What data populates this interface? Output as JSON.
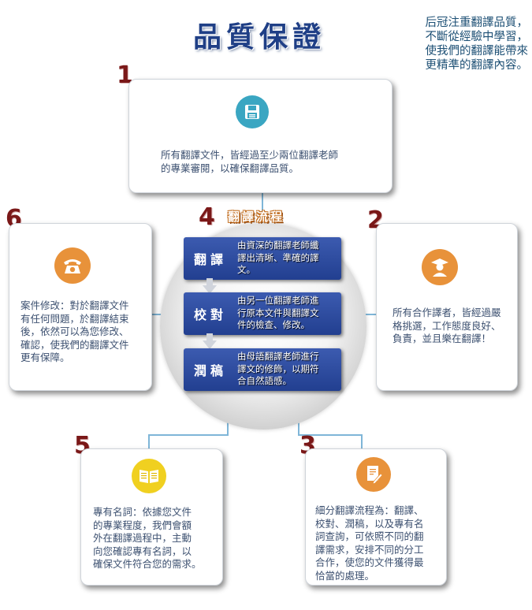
{
  "header": {
    "title": "品質保證",
    "slogan": [
      "后冠注重翻譯品質，",
      "不斷從經驗中學習，",
      "使我們的翻譯能帶來",
      "更精準的翻譯內容。"
    ]
  },
  "cards": [
    {
      "num": "1",
      "icon": "floppy-disk-icon",
      "color": "#3aa6c2",
      "lines": [
        "所有翻譯文件，皆經過至少兩位翻譯老師",
        "的專業審閱，以確保翻譯品質。"
      ]
    },
    {
      "num": "2",
      "icon": "graduate-person-icon",
      "color": "#e8923a",
      "lines": [
        "所有合作譯者，皆經過嚴",
        "格挑選，工作態度良好、",
        "負責，並且樂在翻譯！"
      ]
    },
    {
      "num": "3",
      "icon": "document-pen-icon",
      "color": "#e8923a",
      "lines": [
        "細分翻譯流程為：翻譯、",
        "校對、潤稿，以及專有名",
        "詞查詢，可依照不同的翻",
        "譯需求，安排不同的分工",
        "合作，使您的文件獲得最",
        "恰當的處理。"
      ]
    },
    {
      "num": "5",
      "icon": "open-book-icon",
      "color": "#f0d020",
      "lines": [
        "專有名詞：依據您文件",
        "的專業程度，我們會額",
        "外在翻譯過程中，主動",
        "向您確認專有名詞，以",
        "確保文件符合您的需求。"
      ]
    },
    {
      "num": "6",
      "icon": "telephone-icon",
      "color": "#e8923a",
      "lines": [
        "案件修改：對於翻譯文件",
        "有任何問題，於翻譯結束",
        "後，依然可以為您修改、",
        "確認，使我們的翻譯文件",
        "更有保障。"
      ]
    }
  ],
  "flow": {
    "num": "4",
    "title": "翻譯流程",
    "steps": [
      {
        "label": "翻譯",
        "lines": [
          "由資深的翻譯老師纖",
          "譯出清晰、準確的譯",
          "文。"
        ]
      },
      {
        "label": "校對",
        "lines": [
          "由另一位翻譯老師進",
          "行原本文件與翻譯文",
          "件的檢查、修改。"
        ]
      },
      {
        "label": "潤稿",
        "lines": [
          "由母語翻譯老師進行",
          "譯文的修飾，以期符",
          "合自然語感。"
        ]
      }
    ]
  }
}
